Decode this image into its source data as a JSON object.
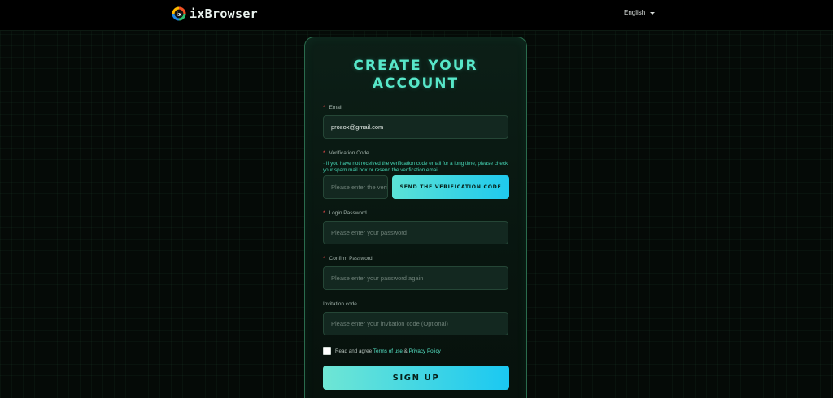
{
  "header": {
    "brand": "ixBrowser",
    "language": "English"
  },
  "form": {
    "title_line1": "CREATE YOUR",
    "title_line2": "ACCOUNT",
    "email": {
      "label": "Email",
      "value": "prosox@gmail.com"
    },
    "verification": {
      "label": "Verification Code",
      "hint": "· If you have not received the verification code email for a long time, please check your spam mail box or resend the verification email",
      "placeholder": "Please enter the verification code",
      "send_button": "SEND THE VERIFICATION CODE"
    },
    "password": {
      "label": "Login Password",
      "placeholder": "Please enter your password"
    },
    "confirm_password": {
      "label": "Confirm Password",
      "placeholder": "Please enter your password again"
    },
    "invitation": {
      "label": "Invitation code",
      "placeholder": "Please enter your invitation code (Optional)"
    },
    "agreement": {
      "prefix": "Read and agree",
      "terms": "Terms of use",
      "separator": "&",
      "privacy": "Privacy Policy"
    },
    "submit": "SIGN UP"
  }
}
